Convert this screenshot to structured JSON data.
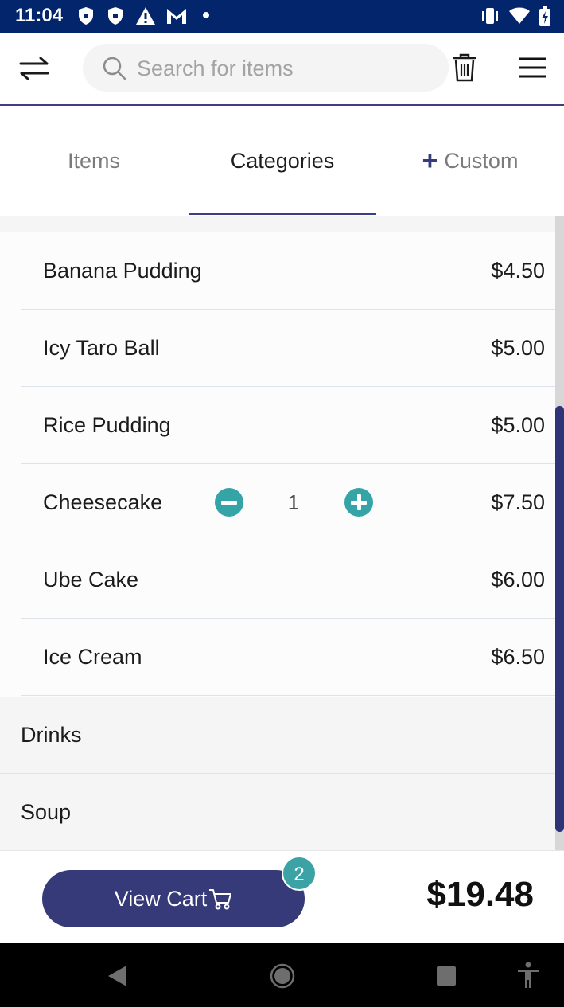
{
  "status_bar": {
    "time": "11:04"
  },
  "search": {
    "placeholder": "Search for items"
  },
  "tabs": [
    {
      "label": "Items",
      "active": false
    },
    {
      "label": "Categories",
      "active": true
    },
    {
      "label": "Custom",
      "active": false
    }
  ],
  "items": [
    {
      "name": "Banana Pudding",
      "price": "$4.50"
    },
    {
      "name": "Icy Taro Ball",
      "price": "$5.00"
    },
    {
      "name": "Rice Pudding",
      "price": "$5.00"
    },
    {
      "name": "Cheesecake",
      "price": "$7.50",
      "quantity": "1"
    },
    {
      "name": "Ube Cake",
      "price": "$6.00"
    },
    {
      "name": "Ice Cream",
      "price": "$6.50"
    }
  ],
  "categories": [
    {
      "name": "Drinks"
    },
    {
      "name": "Soup"
    }
  ],
  "cart": {
    "button_label": "View Cart",
    "badge_count": "2",
    "total": "$19.48"
  },
  "colors": {
    "primary": "#363a78",
    "accent": "#35a4a6",
    "status_bar": "#03256b"
  }
}
